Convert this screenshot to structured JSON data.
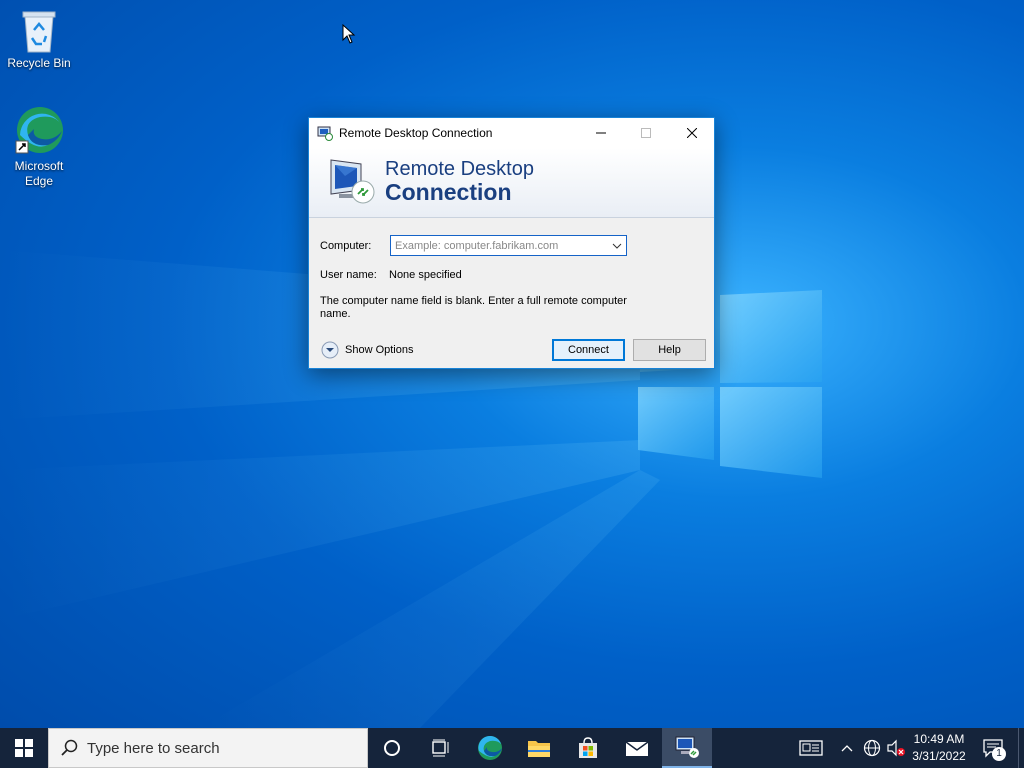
{
  "desktop": {
    "icons": [
      {
        "label": "Recycle Bin"
      },
      {
        "label": "Microsoft Edge"
      }
    ]
  },
  "window": {
    "title": "Remote Desktop Connection",
    "banner_line1": "Remote Desktop",
    "banner_line2": "Connection",
    "computer_label": "Computer:",
    "computer_placeholder": "Example: computer.fabrikam.com",
    "computer_value": "",
    "username_label": "User name:",
    "username_value": "None specified",
    "message": "The computer name field is blank. Enter a full remote computer name.",
    "show_options_label": "Show Options",
    "connect_label": "Connect",
    "help_label": "Help"
  },
  "taskbar": {
    "search_placeholder": "Type here to search",
    "time": "10:49 AM",
    "date": "3/31/2022",
    "notification_count": "1"
  },
  "colors": {
    "accent": "#0078d7",
    "taskbar": "#15243b",
    "banner_text": "#1a3f80"
  }
}
